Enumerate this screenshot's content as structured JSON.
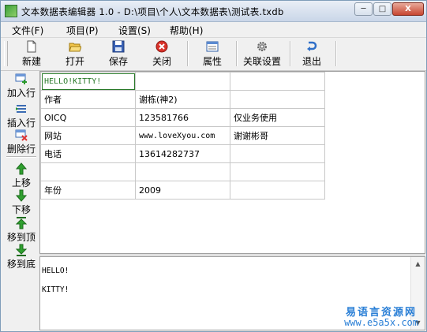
{
  "window": {
    "title": "文本数据表编辑器 1.0 - D:\\项目\\个人\\文本数据表\\测试表.txdb",
    "minimize": "─",
    "maximize": "□",
    "close": "X"
  },
  "menu": [
    "文件(F)",
    "项目(P)",
    "设置(S)",
    "帮助(H)"
  ],
  "toolbar": {
    "new": "新建",
    "open": "打开",
    "save": "保存",
    "close": "关闭",
    "props": "属性",
    "link": "关联设置",
    "exit": "退出"
  },
  "sidebar": {
    "add_row": "加入行",
    "insert_row": "插入行",
    "delete_row": "删除行",
    "move_up": "上移",
    "move_down": "下移",
    "move_top": "移到顶",
    "move_bottom": "移到底"
  },
  "table": {
    "rows": [
      [
        "HELLO!KITTY!",
        "",
        ""
      ],
      [
        "作者",
        "谢栋(神2)",
        ""
      ],
      [
        "OICQ",
        "123581766",
        "仅业务使用"
      ],
      [
        "网站",
        "www.loveXyou.com",
        "谢谢彬哥"
      ],
      [
        "电话",
        "13614282737",
        ""
      ],
      [
        "",
        "",
        ""
      ],
      [
        "年份",
        "2009",
        ""
      ]
    ]
  },
  "editor": {
    "line1": "HELLO!",
    "line2": "KITTY!"
  },
  "watermark": {
    "line1": "易语言资源网",
    "line2": "www.e5a5x.com"
  }
}
